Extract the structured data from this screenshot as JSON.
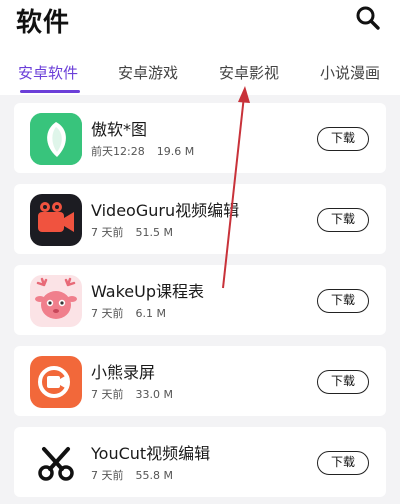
{
  "header": {
    "title": "软件"
  },
  "tabs": [
    {
      "label": "安卓软件",
      "active": true
    },
    {
      "label": "安卓游戏",
      "active": false
    },
    {
      "label": "安卓影视",
      "active": false
    },
    {
      "label": "小说漫画",
      "active": false
    }
  ],
  "apps": [
    {
      "name": "傲软*图",
      "date": "前天12:28",
      "size": "19.6 M",
      "button": "下载",
      "icon": "aoruan-leaf-icon"
    },
    {
      "name": "VideoGuru视频编辑",
      "date": "7 天前",
      "size": "51.5 M",
      "button": "下载",
      "icon": "videoguru-camera-icon"
    },
    {
      "name": "WakeUp课程表",
      "date": "7 天前",
      "size": "6.1 M",
      "button": "下载",
      "icon": "wakeup-deer-icon"
    },
    {
      "name": "小熊录屏",
      "date": "7 天前",
      "size": "33.0 M",
      "button": "下载",
      "icon": "screen-recorder-icon"
    },
    {
      "name": "YouCut视频编辑",
      "date": "7 天前",
      "size": "55.8 M",
      "button": "下载",
      "icon": "youcut-scissors-icon"
    }
  ],
  "colors": {
    "accent": "#6b3fd8",
    "annotation_arrow": "#c8323a"
  }
}
